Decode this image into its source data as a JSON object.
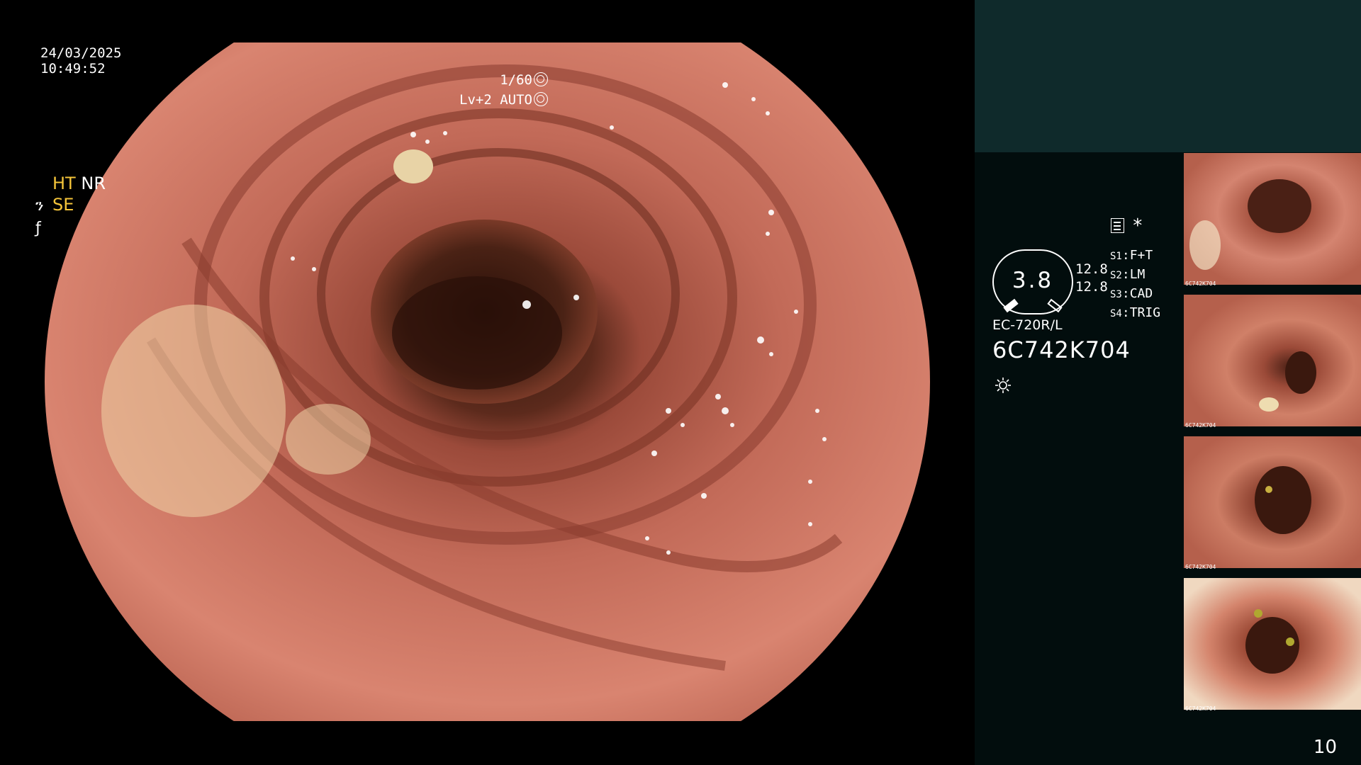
{
  "overlay": {
    "date": "24/03/2025",
    "time": "10:49:52",
    "shutter": "1/60",
    "level": "Lv+2 AUTO"
  },
  "modes": {
    "ht": "HT",
    "nr": "NR",
    "se": "SE"
  },
  "gauge": {
    "value": "3.8",
    "upper": "12.8",
    "lower": "12.8"
  },
  "settings": [
    {
      "key": "S1",
      "value": "F+T"
    },
    {
      "key": "S2",
      "value": "LM"
    },
    {
      "key": "S3",
      "value": "CAD"
    },
    {
      "key": "S4",
      "value": "TRIG"
    }
  ],
  "scope": {
    "model": "EC-720R/L",
    "serial": "6C742K704"
  },
  "thumbnails": [
    {
      "caption": "6C742K704",
      "name": "thumbnail-1"
    },
    {
      "caption": "6C742K704",
      "name": "thumbnail-2"
    },
    {
      "caption": "6C742K704",
      "name": "thumbnail-3"
    },
    {
      "caption": "6C742K704",
      "name": "thumbnail-4"
    }
  ],
  "page_number": "10",
  "colors": {
    "mucosa": "#c8705e",
    "lumen": "#3a1c12",
    "mode_highlight": "#f5c53a",
    "panel_top": "#0f2a2b",
    "panel": "#020d0d"
  }
}
